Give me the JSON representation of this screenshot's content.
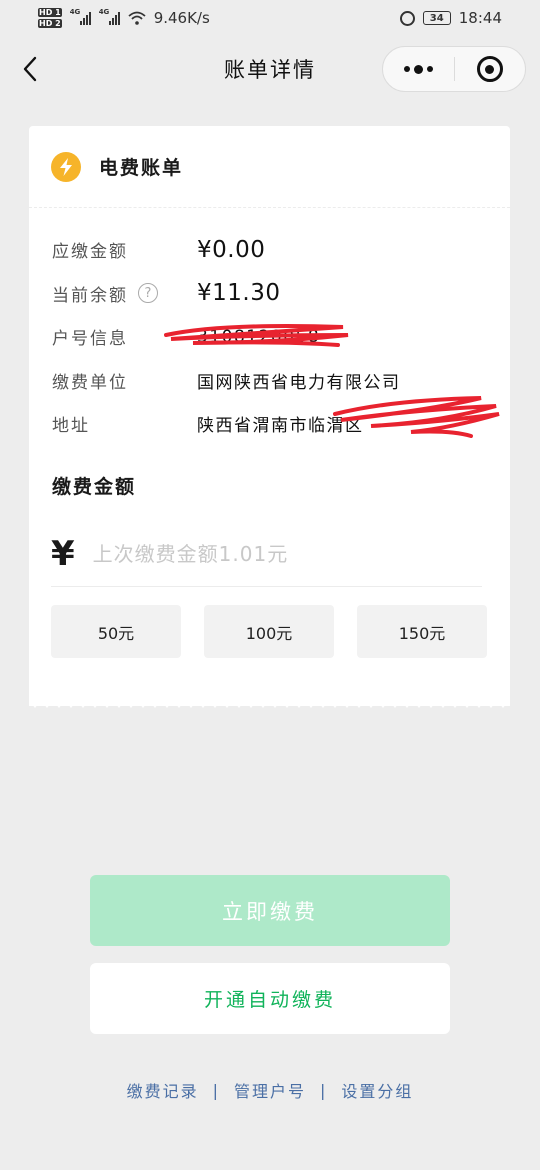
{
  "status_bar": {
    "hd1": "HD 1",
    "hd2": "HD 2",
    "signal1_gen": "4G",
    "signal2_gen": "4G",
    "net_speed": "9.46K/s",
    "battery": "34",
    "time": "18:44"
  },
  "nav": {
    "title": "账单详情"
  },
  "bill": {
    "title": "电费账单",
    "rows": [
      {
        "label": "应缴金额",
        "value": "¥0.00"
      },
      {
        "label": "当前余额",
        "value": "¥11.30"
      },
      {
        "label": "户号信息",
        "value": "3108120058"
      },
      {
        "label": "缴费单位",
        "value": "国网陕西省电力有限公司"
      },
      {
        "label": "地址",
        "value": "陕西省渭南市临渭区"
      }
    ],
    "help_icon": "?"
  },
  "payment": {
    "section_title": "缴费金额",
    "currency": "¥",
    "placeholder": "上次缴费金额1.01元",
    "presets": [
      "50元",
      "100元",
      "150元"
    ]
  },
  "actions": {
    "pay_now": "立即缴费",
    "auto_pay": "开通自动缴费"
  },
  "footer": {
    "links": [
      "缴费记录",
      "管理户号",
      "设置分组"
    ],
    "separator": "|"
  },
  "colors": {
    "accent_green": "#10b35a",
    "disabled_green": "#aee9c9",
    "bolt_orange": "#f6b42a",
    "link_blue": "#4a6fa5",
    "scribble_red": "#e8232f"
  }
}
